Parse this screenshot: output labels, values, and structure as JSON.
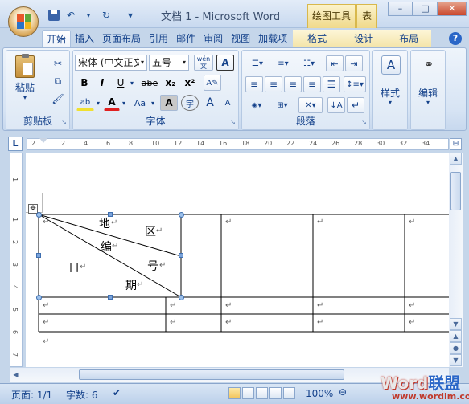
{
  "window": {
    "title": "文档 1 - Microsoft Word",
    "contextual_group": "绘图工具",
    "contextual_table": "表",
    "controls": {
      "minimize": "–",
      "maximize": "□",
      "close": "✕"
    }
  },
  "quick_access": [
    {
      "name": "save-icon",
      "glyph": "💾"
    },
    {
      "name": "undo-icon",
      "glyph": "↶"
    },
    {
      "name": "redo-icon",
      "glyph": "↻"
    },
    {
      "name": "qat-customize-icon",
      "glyph": "▾"
    }
  ],
  "tabs": [
    "开始",
    "插入",
    "页面布局",
    "引用",
    "邮件",
    "审阅",
    "视图",
    "加载项",
    "格式",
    "设计",
    "布局"
  ],
  "active_tab": "开始",
  "ribbon": {
    "clipboard": {
      "label": "剪贴板",
      "paste": "粘贴"
    },
    "font": {
      "label": "字体",
      "font_name": "宋体 (中文正文",
      "font_size": "五号",
      "wen": "wén",
      "bold": "B",
      "italic": "I",
      "underline": "U",
      "strike": "abe",
      "subscript": "x₂",
      "superscript": "x²",
      "aa": "Aa",
      "a_border": "A",
      "char_shade": "A",
      "enclose": "字",
      "grow": "A",
      "shrink": "A"
    },
    "paragraph": {
      "label": "段落"
    },
    "styles": {
      "label": "样式"
    },
    "editing": {
      "label": "编辑"
    }
  },
  "ruler": {
    "corner": "L",
    "h_ticks": [
      "2",
      "2",
      "4",
      "6",
      "8",
      "10",
      "12",
      "14",
      "16",
      "18",
      "20",
      "22",
      "24",
      "26",
      "28",
      "30",
      "32",
      "34"
    ],
    "v_ticks": [
      "1",
      "1",
      "2",
      "3",
      "4",
      "5",
      "6",
      "7"
    ]
  },
  "table": {
    "diagonal_labels": [
      "地",
      "区",
      "编",
      "号",
      "日",
      "期"
    ],
    "paragraph_mark": "↵",
    "move_handle": "✥"
  },
  "status": {
    "page": "页面: 1/1",
    "words": "字数: 6",
    "zoom": "100%"
  },
  "watermark": {
    "word": "Word",
    "cn": "联盟",
    "url": "www.wordlm.com"
  }
}
